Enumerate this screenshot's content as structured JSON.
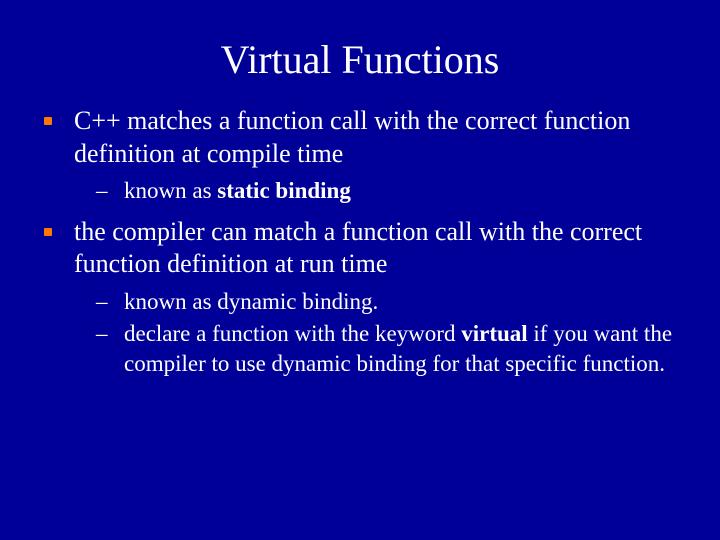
{
  "slide": {
    "title": "Virtual Functions",
    "bullets": [
      {
        "text_pre": "C++ matches a function call with the correct function definition at compile time",
        "sub": [
          {
            "pre": "known as ",
            "bold": "static binding",
            "post": ""
          }
        ]
      },
      {
        "text_pre": "the compiler can match a function call with the correct function definition at run time",
        "sub": [
          {
            "pre": "known as dynamic binding.",
            "bold": "",
            "post": ""
          },
          {
            "pre": "declare a function with the keyword ",
            "bold": "virtual",
            "post": " if you want the compiler to use dynamic binding for that specific function."
          }
        ]
      }
    ]
  }
}
